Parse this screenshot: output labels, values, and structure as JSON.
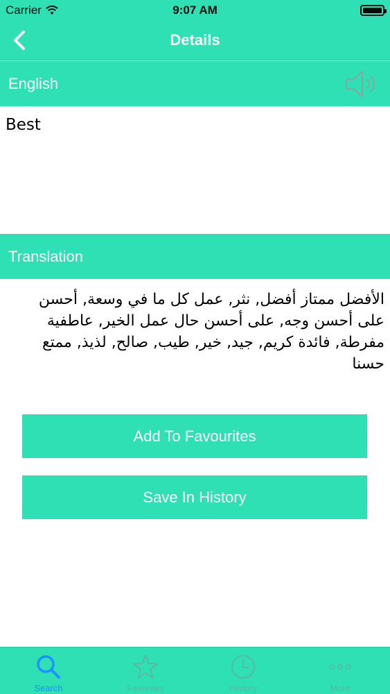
{
  "status_bar": {
    "carrier": "Carrier",
    "time": "9:07 AM"
  },
  "nav": {
    "title": "Details",
    "back_icon": "chevron-left-icon"
  },
  "english": {
    "header": "English",
    "text": "Best",
    "speaker_icon": "speaker-icon"
  },
  "translation": {
    "header": "Translation",
    "text": "الأفضل ممتاز أفضل, نثر, عمل كل ما في وسعة, أحسن على أحسن وجه, على أحسن حال عمل الخير, عاطفية مفرطة, فائدة كريم, جيد, خير, طيب, صالح, لذيذ, ممتع حسنا"
  },
  "buttons": {
    "add_favourites": "Add To Favourites",
    "save_history": "Save In History"
  },
  "tabs": [
    {
      "label": "Search",
      "icon": "search-icon",
      "active": true
    },
    {
      "label": "Favorites",
      "icon": "star-icon",
      "active": false
    },
    {
      "label": "History",
      "icon": "clock-icon",
      "active": false
    },
    {
      "label": "More",
      "icon": "more-icon",
      "active": false
    }
  ],
  "colors": {
    "accent": "#2ee0b4",
    "active_tab": "#1e90ff",
    "inactive_tab": "#5ab7a0"
  }
}
